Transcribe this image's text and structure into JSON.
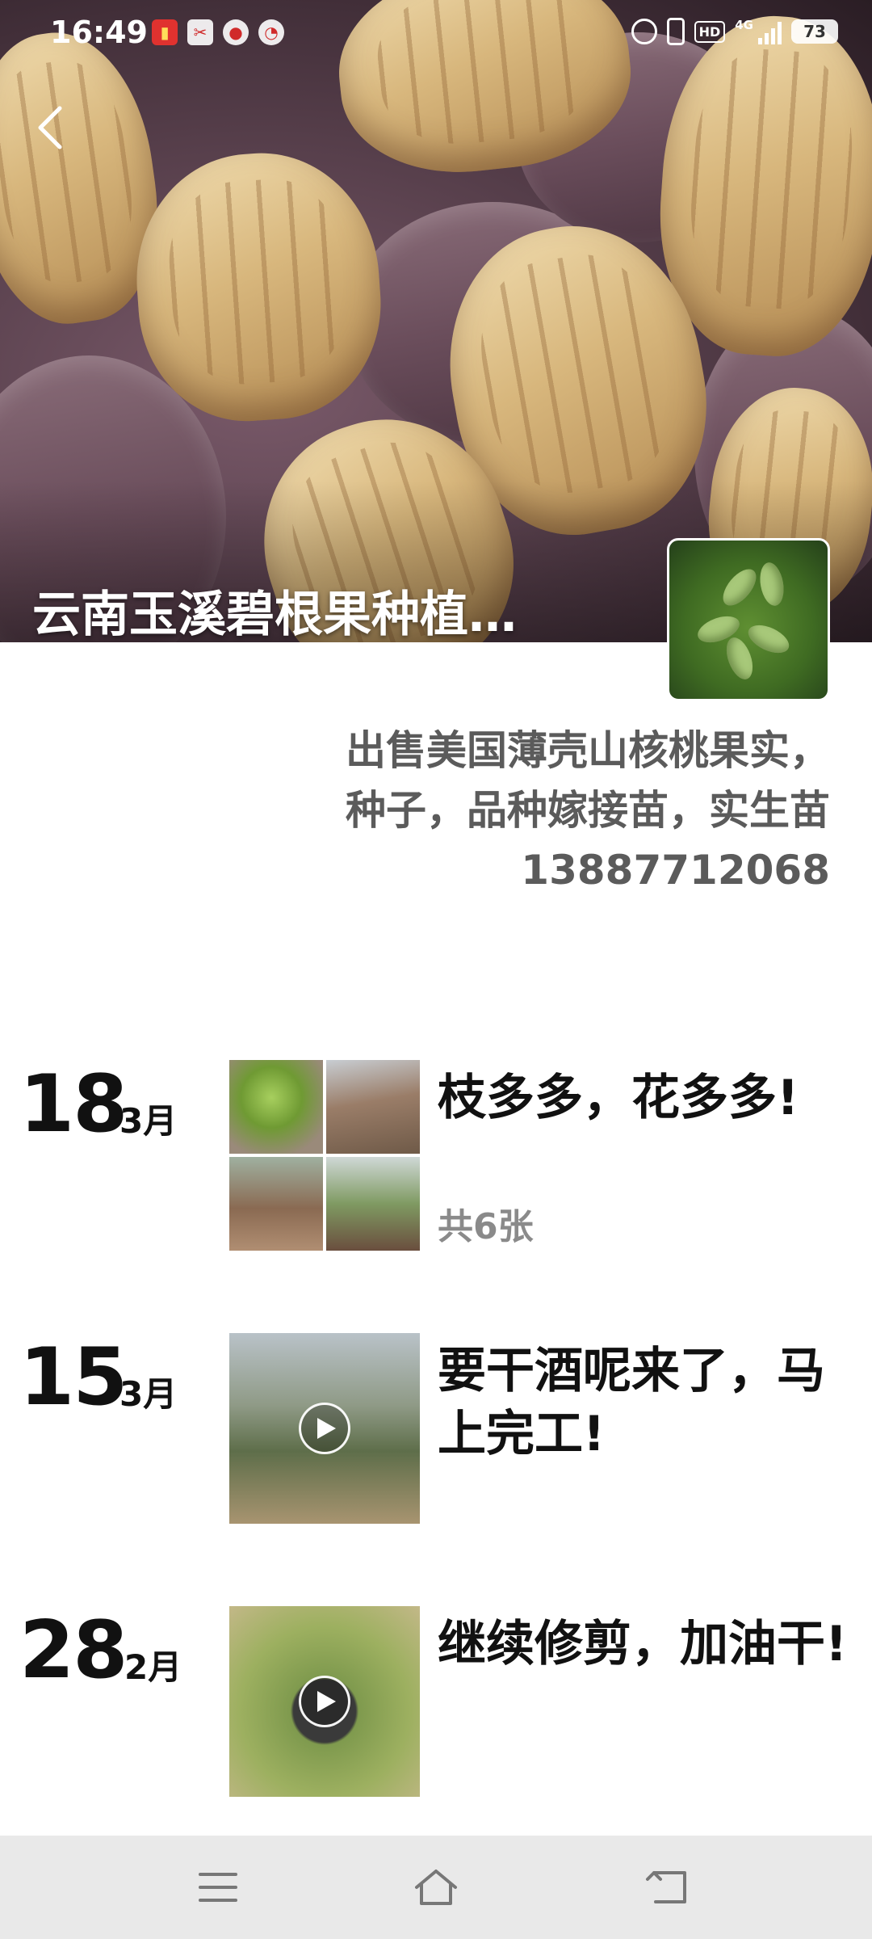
{
  "status_bar": {
    "time": "16:49",
    "battery": "73",
    "network": "4G",
    "hd": "HD"
  },
  "cover": {
    "title": "云南玉溪碧根果种植…"
  },
  "profile": {
    "signature_line1": "出售美国薄壳山核桃果实，",
    "signature_line2": "种子，品种嫁接苗，实生苗",
    "phone": "13887712068"
  },
  "posts": [
    {
      "day": "18",
      "month": "3月",
      "text": "枝多多，花多多!",
      "count": "共6张",
      "media": "image-grid"
    },
    {
      "day": "15",
      "month": "3月",
      "text": "要干酒呢来了，马上完工!",
      "media": "video"
    },
    {
      "day": "28",
      "month": "2月",
      "text": "继续修剪，加油干!",
      "media": "video"
    }
  ],
  "nav": {
    "icons": [
      "menu-icon",
      "home-icon",
      "back-icon"
    ]
  }
}
